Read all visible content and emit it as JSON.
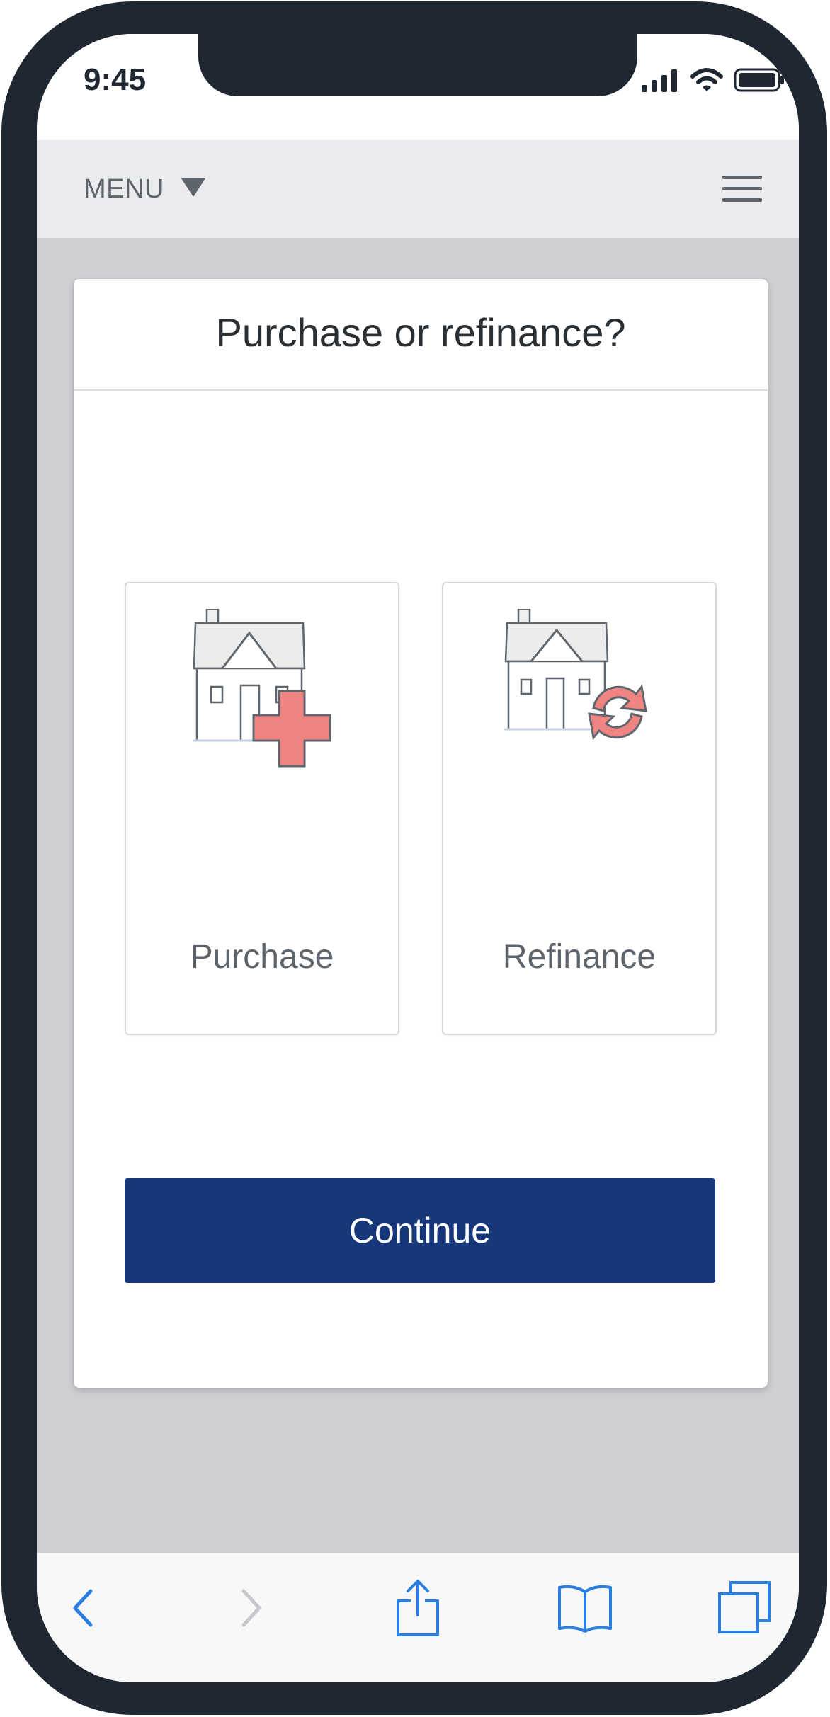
{
  "status_bar": {
    "time": "9:45",
    "icons": [
      "signal-icon",
      "wifi-icon",
      "battery-icon"
    ]
  },
  "nav": {
    "menu_label": "MENU",
    "menu_icon": "caret-down-icon",
    "hamburger_icon": "hamburger-menu-icon"
  },
  "card": {
    "title": "Purchase or refinance?",
    "options": [
      {
        "label": "Purchase",
        "icon": "house-plus-icon"
      },
      {
        "label": "Refinance",
        "icon": "house-refresh-icon"
      }
    ],
    "continue_label": "Continue"
  },
  "toolbar": {
    "icons": [
      "back-icon",
      "forward-icon",
      "share-icon",
      "bookmarks-icon",
      "tabs-icon"
    ]
  },
  "colors": {
    "primary_button": "#17377b",
    "accent_icon": "#ef8482",
    "toolbar_icon": "#2a7de1",
    "toolbar_icon_disabled": "#c7c8cc"
  }
}
